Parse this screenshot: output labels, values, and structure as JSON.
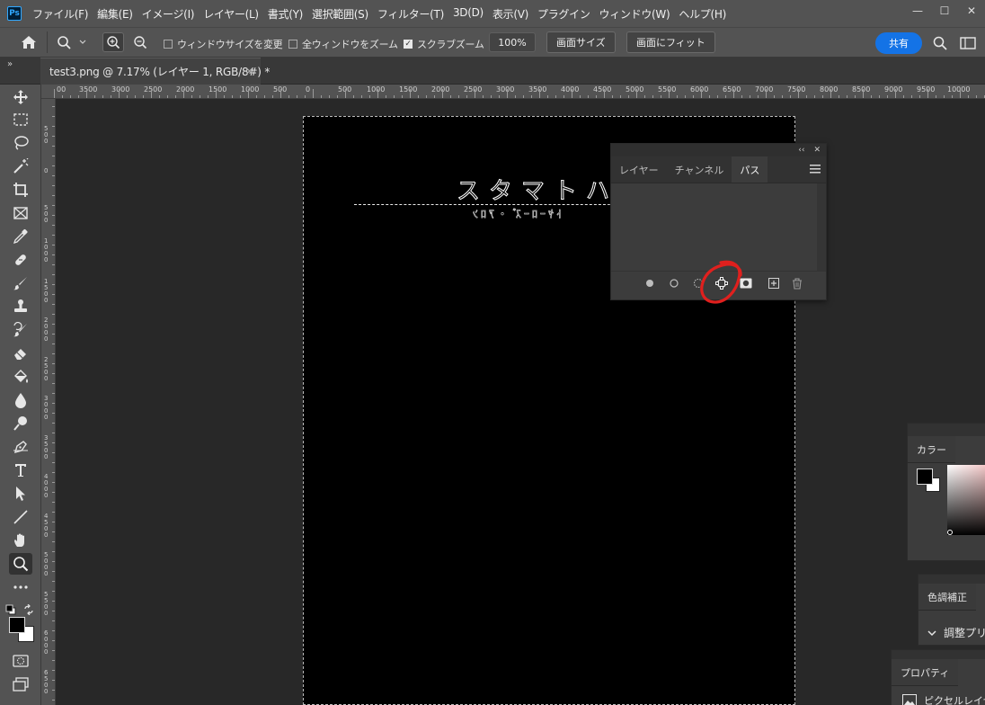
{
  "app": {
    "logo": "Ps"
  },
  "menu": [
    "ファイル(F)",
    "編集(E)",
    "イメージ(I)",
    "レイヤー(L)",
    "書式(Y)",
    "選択範囲(S)",
    "フィルター(T)",
    "3D(D)",
    "表示(V)",
    "プラグイン",
    "ウィンドウ(W)",
    "ヘルプ(H)"
  ],
  "window_controls": {
    "minimize": "—",
    "maximize": "☐",
    "close": "✕"
  },
  "options": {
    "resize_windows": "ウィンドウサイズを変更",
    "all_windows": "全ウィンドウをズーム",
    "scrubby_zoom": "スクラブズーム",
    "zoom": "100%",
    "fit_screen": "画面サイズ",
    "fill_screen": "画面にフィット",
    "share": "共有"
  },
  "tab": {
    "collapse": "»",
    "title": "test3.png @ 7.17% (レイヤー 1, RGB/8#) *",
    "close": "✕"
  },
  "ruler": {
    "h_labels": [
      "00",
      "3500",
      "3000",
      "2500",
      "2000",
      "1500",
      "1000",
      "500",
      "0",
      "500",
      "1000",
      "1500",
      "2000",
      "2500",
      "3000",
      "3500",
      "4000",
      "4500",
      "5000",
      "5500",
      "6000",
      "6500",
      "7000",
      "7500",
      "8000",
      "8500",
      "9000",
      "9500",
      "10000"
    ],
    "v_labels": [
      "5\n0\n0",
      "0",
      "5\n0\n0",
      "1\n0\n0\n0",
      "1\n5\n0\n0",
      "2\n0\n0\n0",
      "2\n5\n0\n0",
      "3\n0\n0\n0",
      "3\n5\n0\n0",
      "4\n0\n0\n0",
      "4\n5\n0\n0",
      "5\n0\n0\n0",
      "5\n5\n0\n0",
      "6\n0\n0\n0",
      "6\n5\n0\n0"
    ]
  },
  "canvas": {
    "line1": "スタマトハペ",
    "line2": "ﾄﾔｰﾛｰｽﾞ・ｱﾛﾝ"
  },
  "paths_panel": {
    "collapse": "‹‹",
    "close": "✕",
    "tabs": [
      "レイヤー",
      "チャンネル",
      "パス"
    ],
    "active_tab": 2,
    "menu_icon": "hamburger-menu-icon",
    "buttons": [
      "fill-path-icon",
      "stroke-path-icon",
      "load-selection-icon",
      "make-work-path-icon",
      "add-mask-icon",
      "new-path-icon",
      "delete-path-icon"
    ]
  },
  "color_panel": {
    "tab": "カラー"
  },
  "adjust_panel": {
    "tab": "色調補正",
    "item": "調整プリセ"
  },
  "props_panel": {
    "tab": "プロパティ",
    "item": "ピクセルレイヤ"
  },
  "colors": {
    "accent": "#1473e6",
    "annotation": "#e0201e"
  }
}
